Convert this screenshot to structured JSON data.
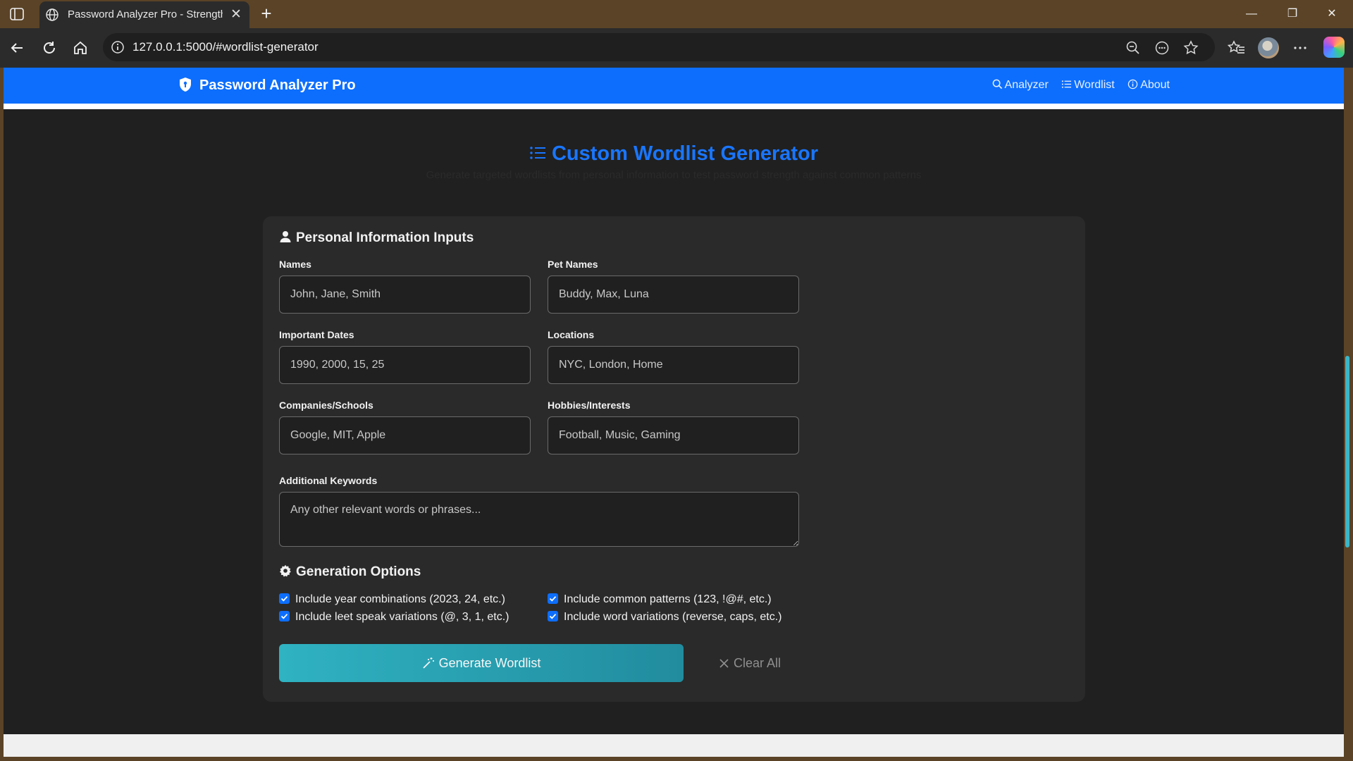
{
  "browser": {
    "tab_title": "Password Analyzer Pro - Strength",
    "url": "127.0.0.1:5000/#wordlist-generator"
  },
  "app": {
    "brand": "Password Analyzer Pro",
    "nav": [
      {
        "label": "Analyzer",
        "icon": "search-icon"
      },
      {
        "label": "Wordlist",
        "icon": "list-icon"
      },
      {
        "label": "About",
        "icon": "info-icon"
      }
    ]
  },
  "page": {
    "title": "Custom Wordlist Generator",
    "subtitle": "Generate targeted wordlists from personal information to test password strength against common patterns"
  },
  "personal": {
    "heading": "Personal Information Inputs",
    "fields": [
      {
        "label": "Names",
        "placeholder": "John, Jane, Smith"
      },
      {
        "label": "Pet Names",
        "placeholder": "Buddy, Max, Luna"
      },
      {
        "label": "Important Dates",
        "placeholder": "1990, 2000, 15, 25"
      },
      {
        "label": "Locations",
        "placeholder": "NYC, London, Home"
      },
      {
        "label": "Companies/Schools",
        "placeholder": "Google, MIT, Apple"
      },
      {
        "label": "Hobbies/Interests",
        "placeholder": "Football, Music, Gaming"
      }
    ],
    "keywords": {
      "label": "Additional Keywords",
      "placeholder": "Any other relevant words or phrases..."
    }
  },
  "options": {
    "heading": "Generation Options",
    "items": [
      {
        "label": "Include year combinations (2023, 24, etc.)",
        "checked": true
      },
      {
        "label": "Include common patterns (123, !@#, etc.)",
        "checked": true
      },
      {
        "label": "Include leet speak variations (@, 3, 1, etc.)",
        "checked": true
      },
      {
        "label": "Include word variations (reverse, caps, etc.)",
        "checked": true
      }
    ]
  },
  "actions": {
    "generate": "Generate Wordlist",
    "clear": "Clear All"
  },
  "colors": {
    "brand_blue": "#0d6efd",
    "title_blue": "#1976ff",
    "generate_teal": "#2fb2c2",
    "chrome_brown": "#5b4327"
  }
}
